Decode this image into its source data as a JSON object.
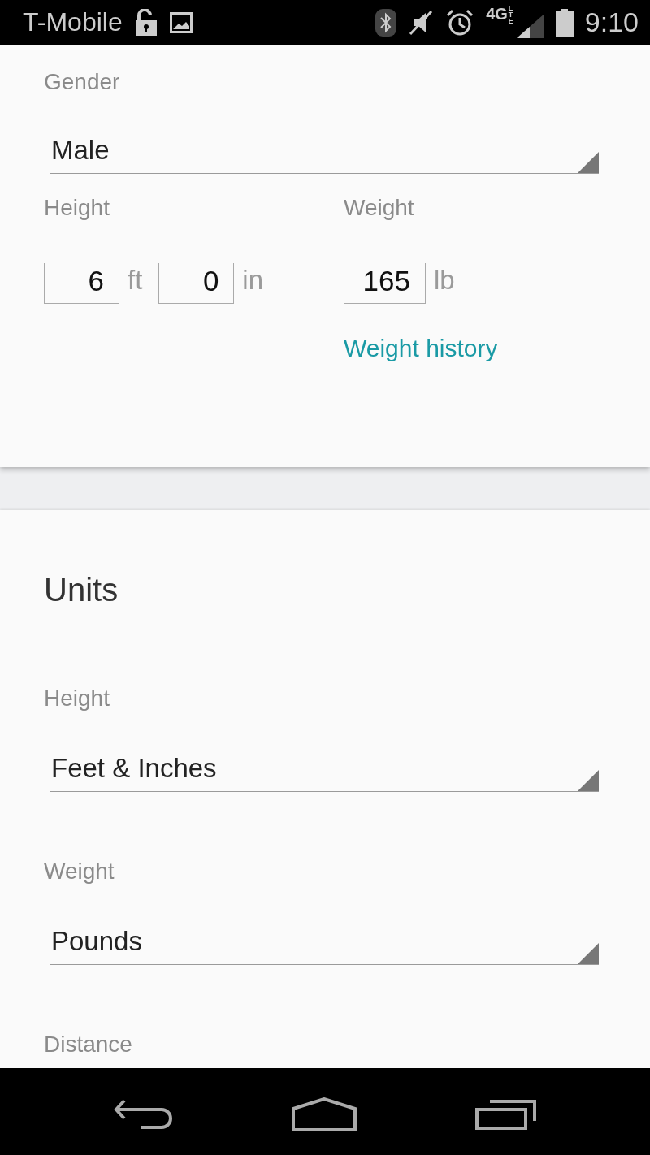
{
  "status_bar": {
    "carrier": "T-Mobile",
    "network": "4G",
    "network_sub": "LTE",
    "time": "9:10"
  },
  "profile": {
    "gender": {
      "label": "Gender",
      "value": "Male"
    },
    "height": {
      "label": "Height",
      "fields": [
        {
          "value": "6",
          "unit": "ft"
        },
        {
          "value": "0",
          "unit": "in"
        }
      ]
    },
    "weight": {
      "label": "Weight",
      "fields": [
        {
          "value": "165",
          "unit": "lb"
        }
      ],
      "link": "Weight history"
    }
  },
  "units": {
    "title": "Units",
    "settings": [
      {
        "label": "Height",
        "value": "Feet & Inches"
      },
      {
        "label": "Weight",
        "value": "Pounds"
      },
      {
        "label": "Distance"
      }
    ]
  }
}
